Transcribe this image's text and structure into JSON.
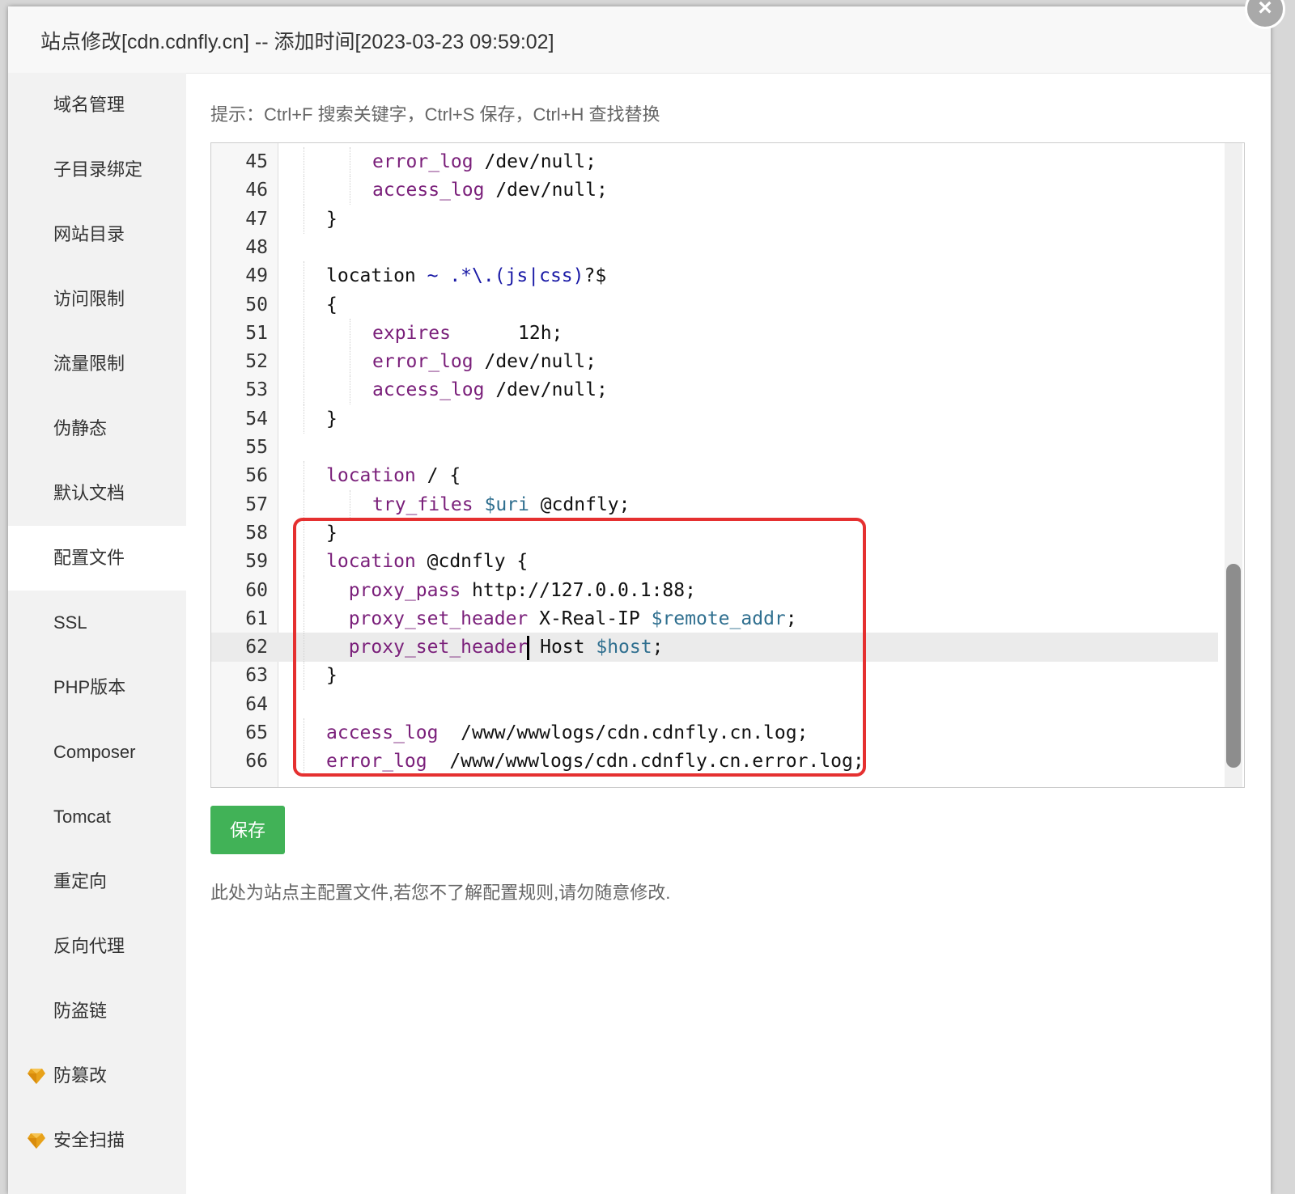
{
  "window": {
    "title": "站点修改[cdn.cdnfly.cn] -- 添加时间[2023-03-23 09:59:02]",
    "close_label": "×"
  },
  "sidebar": {
    "items": [
      {
        "label": "域名管理",
        "active": false,
        "icon": ""
      },
      {
        "label": "子目录绑定",
        "active": false,
        "icon": ""
      },
      {
        "label": "网站目录",
        "active": false,
        "icon": ""
      },
      {
        "label": "访问限制",
        "active": false,
        "icon": ""
      },
      {
        "label": "流量限制",
        "active": false,
        "icon": ""
      },
      {
        "label": "伪静态",
        "active": false,
        "icon": ""
      },
      {
        "label": "默认文档",
        "active": false,
        "icon": ""
      },
      {
        "label": "配置文件",
        "active": true,
        "icon": ""
      },
      {
        "label": "SSL",
        "active": false,
        "icon": ""
      },
      {
        "label": "PHP版本",
        "active": false,
        "icon": ""
      },
      {
        "label": "Composer",
        "active": false,
        "icon": ""
      },
      {
        "label": "Tomcat",
        "active": false,
        "icon": ""
      },
      {
        "label": "重定向",
        "active": false,
        "icon": ""
      },
      {
        "label": "反向代理",
        "active": false,
        "icon": ""
      },
      {
        "label": "防盗链",
        "active": false,
        "icon": ""
      },
      {
        "label": "防篡改",
        "active": false,
        "icon": "gem-icon"
      },
      {
        "label": "安全扫描",
        "active": false,
        "icon": "gem-icon"
      }
    ]
  },
  "content": {
    "tip": "提示：Ctrl+F 搜索关键字，Ctrl+S 保存，Ctrl+H 查找替换",
    "save_label": "保存",
    "note": "此处为站点主配置文件,若您不了解配置规则,请勿随意修改."
  },
  "editor": {
    "active_line": "62",
    "lines": [
      {
        "n": "45",
        "parts": [
          [
            "kw",
            "error_log"
          ],
          [
            "",
            " /dev/null;"
          ]
        ],
        "indent": 2
      },
      {
        "n": "46",
        "parts": [
          [
            "kw",
            "access_log"
          ],
          [
            "",
            " /dev/null;"
          ]
        ],
        "indent": 2
      },
      {
        "n": "47",
        "parts": [
          [
            "",
            "}"
          ]
        ],
        "indent": 1
      },
      {
        "n": "48",
        "parts": [],
        "indent": 0
      },
      {
        "n": "49",
        "parts": [
          [
            "",
            "location "
          ],
          [
            "re",
            "~ .*\\.(js|css)"
          ],
          [
            "",
            "?$"
          ]
        ],
        "indent": 1
      },
      {
        "n": "50",
        "parts": [
          [
            "",
            "{"
          ]
        ],
        "indent": 1
      },
      {
        "n": "51",
        "parts": [
          [
            "kw",
            "expires"
          ],
          [
            "",
            "      12h;"
          ]
        ],
        "indent": 2
      },
      {
        "n": "52",
        "parts": [
          [
            "kw",
            "error_log"
          ],
          [
            "",
            " /dev/null;"
          ]
        ],
        "indent": 2
      },
      {
        "n": "53",
        "parts": [
          [
            "kw",
            "access_log"
          ],
          [
            "",
            " /dev/null;"
          ]
        ],
        "indent": 2
      },
      {
        "n": "54",
        "parts": [
          [
            "",
            "}"
          ]
        ],
        "indent": 1
      },
      {
        "n": "55",
        "parts": [],
        "indent": 0
      },
      {
        "n": "56",
        "parts": [
          [
            "kw",
            "location"
          ],
          [
            "",
            " / {"
          ]
        ],
        "indent": 1
      },
      {
        "n": "57",
        "parts": [
          [
            "kw",
            "try_files"
          ],
          [
            "",
            " "
          ],
          [
            "var",
            "$uri"
          ],
          [
            "",
            " @cdnfly;"
          ]
        ],
        "indent": 2
      },
      {
        "n": "58",
        "parts": [
          [
            "",
            "}"
          ]
        ],
        "indent": 1
      },
      {
        "n": "59",
        "parts": [
          [
            "kw",
            "location"
          ],
          [
            "",
            " @cdnfly {"
          ]
        ],
        "indent": 1
      },
      {
        "n": "60",
        "parts": [
          [
            "",
            "  "
          ],
          [
            "kw",
            "proxy_pass"
          ],
          [
            "",
            " http://127.0.0.1:88;"
          ]
        ],
        "indent": 1
      },
      {
        "n": "61",
        "parts": [
          [
            "",
            "  "
          ],
          [
            "kw",
            "proxy_set_header"
          ],
          [
            "",
            " X-Real-IP "
          ],
          [
            "var",
            "$remote_addr"
          ],
          [
            "",
            ";"
          ]
        ],
        "indent": 1
      },
      {
        "n": "62",
        "parts": [
          [
            "",
            "  "
          ],
          [
            "kw",
            "proxy_set_header"
          ],
          [
            "cursor",
            ""
          ],
          [
            "",
            " Host "
          ],
          [
            "var",
            "$host"
          ],
          [
            "",
            ";"
          ]
        ],
        "indent": 1
      },
      {
        "n": "63",
        "parts": [
          [
            "",
            "}"
          ]
        ],
        "indent": 1
      },
      {
        "n": "64",
        "parts": [],
        "indent": 0
      },
      {
        "n": "65",
        "parts": [
          [
            "kw",
            "access_log"
          ],
          [
            "",
            "  /www/wwwlogs/cdn.cdnfly.cn.log;"
          ]
        ],
        "indent": 1
      },
      {
        "n": "66",
        "parts": [
          [
            "kw",
            "error_log"
          ],
          [
            "",
            "  /www/wwwlogs/cdn.cdnfly.cn.error.log;"
          ]
        ],
        "indent": 1
      }
    ]
  },
  "colors": {
    "save_button": "#20a53a",
    "highlight_box": "#e53030",
    "keyword": "#7a1f7a",
    "variable": "#2f6f8f"
  }
}
